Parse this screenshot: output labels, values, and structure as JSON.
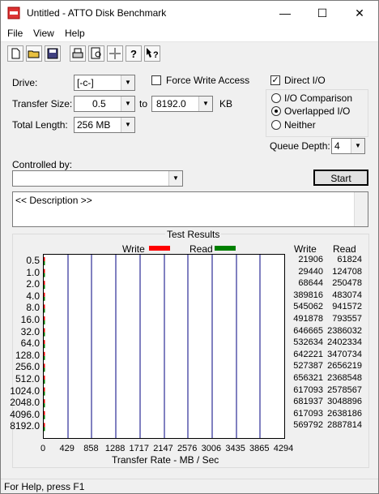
{
  "window": {
    "title": "Untitled - ATTO Disk Benchmark"
  },
  "caption": {
    "min": "—",
    "max": "☐",
    "close": "✕"
  },
  "menu": {
    "file": "File",
    "view": "View",
    "help": "Help"
  },
  "toolbar": [
    "new-icon",
    "open-icon",
    "save-icon",
    "print-icon",
    "print-preview-icon",
    "move-icon",
    "help-icon",
    "context-help-icon"
  ],
  "form": {
    "drive_label": "Drive:",
    "drive_value": "[-c-]",
    "force_write_label": "Force Write Access",
    "direct_io_label": "Direct I/O",
    "transfer_size_label": "Transfer Size:",
    "transfer_from": "0.5",
    "to_label": "to",
    "transfer_to": "8192.0",
    "kb_label": "KB",
    "total_length_label": "Total Length:",
    "total_length_value": "256 MB",
    "io_comparison_label": "I/O Comparison",
    "overlapped_io_label": "Overlapped I/O",
    "neither_label": "Neither",
    "queue_depth_label": "Queue Depth:",
    "queue_depth_value": "4",
    "controlled_by_label": "Controlled by:",
    "controlled_by_value": "",
    "start_label": "Start",
    "description": "<< Description >>"
  },
  "results": {
    "group_label": "Test Results",
    "write_legend": "Write",
    "read_legend": "Read",
    "write_header": "Write",
    "read_header": "Read",
    "xlabel": "Transfer Rate - MB / Sec"
  },
  "chart_data": {
    "type": "bar",
    "orientation": "horizontal",
    "categories": [
      "0.5",
      "1.0",
      "2.0",
      "4.0",
      "8.0",
      "16.0",
      "32.0",
      "64.0",
      "128.0",
      "256.0",
      "512.0",
      "1024.0",
      "2048.0",
      "4096.0",
      "8192.0"
    ],
    "series": [
      {
        "name": "Write",
        "color": "#ff0000",
        "values": [
          21906,
          29440,
          68644,
          389816,
          545062,
          491878,
          646665,
          532634,
          642221,
          527387,
          656321,
          617093,
          681937,
          617093,
          569792
        ]
      },
      {
        "name": "Read",
        "color": "#008000",
        "values": [
          61824,
          124708,
          250478,
          483074,
          941572,
          793557,
          2386032,
          2402334,
          3470734,
          2656219,
          2368548,
          2578567,
          3048896,
          2638186,
          2887814
        ]
      }
    ],
    "x_ticks": [
      "0",
      "429",
      "858",
      "1288",
      "1717",
      "2147",
      "2576",
      "3006",
      "3435",
      "3865",
      "4294"
    ],
    "xlim": [
      0,
      4294
    ],
    "grid": true,
    "xlabel": "Transfer Rate - MB / Sec"
  },
  "status": {
    "text": "For Help, press F1"
  }
}
